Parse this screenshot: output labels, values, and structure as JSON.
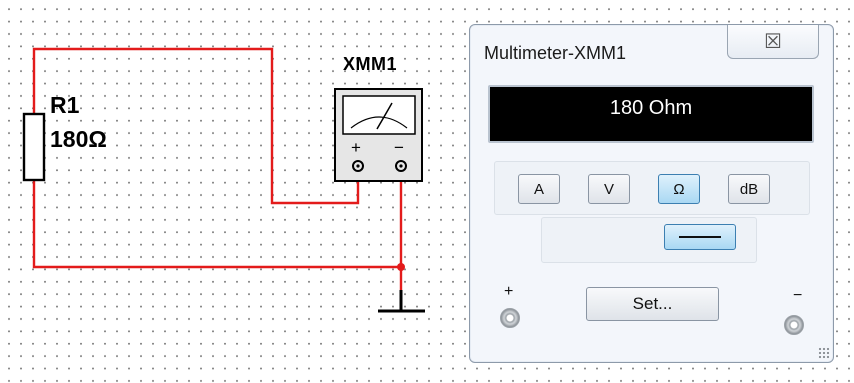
{
  "schematic": {
    "resistor": {
      "name": "R1",
      "value": "180Ω"
    },
    "instrument": {
      "name": "XMM1",
      "plus_sign": "+",
      "minus_sign": "−"
    },
    "colors": {
      "wire": "#e31b1b",
      "component": "#000000",
      "junction": "#e31b1b"
    }
  },
  "multimeter": {
    "title": "Multimeter-XMM1",
    "close_icon": "close-icon",
    "close_glyph": "☒",
    "reading": "180 Ohm",
    "modes": [
      {
        "label": "A",
        "active": false
      },
      {
        "label": "V",
        "active": false
      },
      {
        "label": "Ω",
        "active": true
      },
      {
        "label": "dB",
        "active": false
      }
    ],
    "signal_mode": {
      "icon": "dc-line-icon",
      "active": true
    },
    "set_label": "Set...",
    "terminals": {
      "plus": "+",
      "minus": "−"
    },
    "colors": {
      "display_bg": "#000000",
      "display_text": "#ffffff",
      "active_button": "#a9d8f3"
    }
  }
}
